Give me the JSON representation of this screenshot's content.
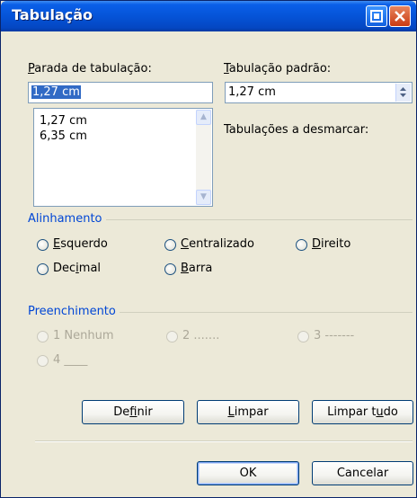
{
  "window": {
    "title": "Tabulação"
  },
  "tab_stop": {
    "label_ul": "P",
    "label_rest": "arada de tabulação:",
    "value": "1,27 cm",
    "list": [
      "1,27 cm",
      "6,35 cm"
    ]
  },
  "default_tab": {
    "label_ul": "T",
    "label_rest": "abulação padrão:",
    "value": "1,27 cm"
  },
  "clear_label": "Tabulações a desmarcar:",
  "alignment": {
    "title": "Alinhamento",
    "options": [
      {
        "ul": "E",
        "rest": "squerdo"
      },
      {
        "ul": "C",
        "rest": "entralizado"
      },
      {
        "ul": "D",
        "rest": "ireito"
      },
      {
        "pre": "Dec",
        "ul": "i",
        "rest": "mal"
      },
      {
        "ul": "B",
        "rest": "arra"
      }
    ]
  },
  "leader": {
    "title": "Preenchimento",
    "options": [
      "1 Nenhum",
      "2 .......",
      "3 -------",
      "4 ____"
    ]
  },
  "buttons": {
    "set": {
      "pre": "De",
      "ul": "f",
      "rest": "inir"
    },
    "clear": {
      "ul": "L",
      "rest": "impar"
    },
    "clear_all": {
      "pre": "Limpar t",
      "ul": "u",
      "rest": "do"
    },
    "ok": "OK",
    "cancel": "Cancelar"
  },
  "icons": {
    "help": "help-icon",
    "close": "close-icon"
  }
}
